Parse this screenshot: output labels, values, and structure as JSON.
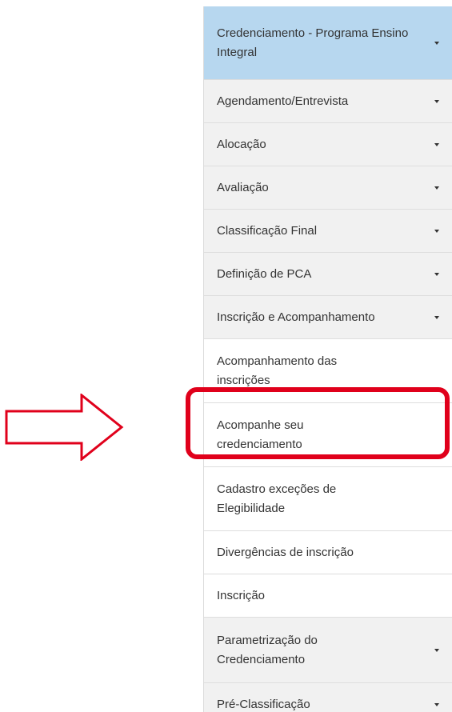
{
  "menu": {
    "items": [
      {
        "label": "Credenciamento - Programa Ensino Integral",
        "icon": "caret-down-icon"
      },
      {
        "label": "Agendamento/Entrevista",
        "icon": "caret-down-icon"
      },
      {
        "label": "Alocação",
        "icon": "caret-down-icon"
      },
      {
        "label": "Avaliação",
        "icon": "caret-down-icon"
      },
      {
        "label": "Classificação Final",
        "icon": "caret-down-icon"
      },
      {
        "label": "Definição de PCA",
        "icon": "caret-down-icon"
      },
      {
        "label": "Inscrição e Acompanhamento",
        "icon": "caret-down-icon"
      },
      {
        "label": "Acompanhamento das inscrições"
      },
      {
        "label": "Acompanhe seu credenciamento"
      },
      {
        "label": "Cadastro exceções de Elegibilidade"
      },
      {
        "label": "Divergências de inscrição"
      },
      {
        "label": "Inscrição"
      },
      {
        "label": "Parametrização do Credenciamento",
        "icon": "caret-down-icon"
      },
      {
        "label": "Pré-Classificação",
        "icon": "caret-down-icon"
      }
    ]
  },
  "annotation": {
    "highlight_color": "#e0001b",
    "arrow_icon": "right-arrow-icon",
    "highlighted_item": "Acompanhe seu credenciamento"
  },
  "colors": {
    "active_bg": "#b7d7ef",
    "parent_bg": "#f1f1f1",
    "sub_bg": "#ffffff"
  }
}
